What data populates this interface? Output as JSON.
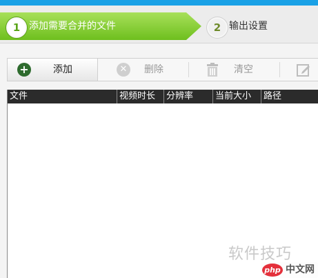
{
  "wizard": {
    "steps": [
      {
        "number": "1",
        "label": "添加需要合并的文件",
        "active": true
      },
      {
        "number": "2",
        "label": "输出设置",
        "active": false
      }
    ],
    "active_color": "#7ac62a"
  },
  "toolbar": {
    "add_label": "添加",
    "delete_label": "删除",
    "clear_label": "清空"
  },
  "icons": {
    "add": "plus-circle-icon",
    "delete": "x-circle-icon",
    "clear": "trash-icon",
    "edit": "edit-icon"
  },
  "table": {
    "columns": [
      "文件",
      "视频时长",
      "分辨率",
      "当前大小",
      "路径"
    ],
    "rows": []
  },
  "watermark": {
    "text": "软件技巧",
    "badge_logo": "php",
    "badge_text": "中文网"
  }
}
